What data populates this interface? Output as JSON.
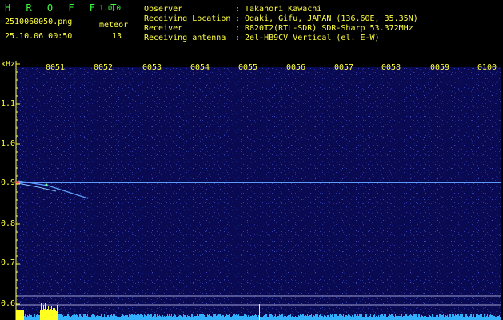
{
  "app": {
    "name": "H R O F F T",
    "version": "1.0.0"
  },
  "file": {
    "name": "2510060050.png",
    "datetime": "25.10.06 00:50"
  },
  "meteor": {
    "label": "meteor",
    "count": "13"
  },
  "info": [
    {
      "key": "Observer",
      "sep": ":",
      "value": "Takanori Kawachi"
    },
    {
      "key": "Receiving Location",
      "sep": ":",
      "value": "Ogaki, Gifu, JAPAN (136.60E, 35.35N)"
    },
    {
      "key": "Receiver",
      "sep": ":",
      "value": "R820T2(RTL-SDR) SDR-Sharp 53.372MHz"
    },
    {
      "key": "Receiving antenna",
      "sep": ":",
      "value": "2el-HB9CV Vertical (el. E-W)"
    }
  ],
  "axis": {
    "unit": "kHz",
    "freq_ticks": [
      "1.1",
      "1.0",
      "0.9",
      "0.8",
      "0.7",
      "0.6"
    ],
    "time_ticks": [
      "0051",
      "0052",
      "0053",
      "0054",
      "0055",
      "0056",
      "0057",
      "0058",
      "0059",
      "0100"
    ]
  },
  "colors": {
    "background": "#000000",
    "spectrum": "#0a0a50",
    "carrier": "#5fb0ff",
    "label": "#ffff40",
    "title": "#3cff3c"
  }
}
